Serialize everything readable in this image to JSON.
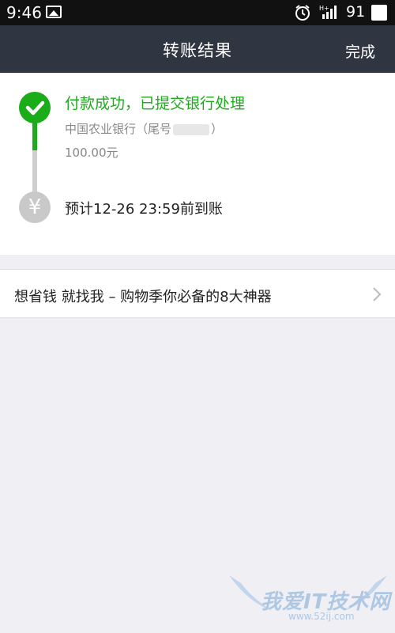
{
  "status_bar": {
    "time": "9:46",
    "battery": "91",
    "icons": [
      "image-icon",
      "alarm-icon",
      "signal-icon",
      "battery-icon"
    ]
  },
  "nav": {
    "title": "转账结果",
    "done_label": "完成"
  },
  "transfer": {
    "status": "付款成功，已提交银行处理",
    "bank_prefix": "中国农业银行（尾号",
    "bank_suffix": "）",
    "amount": "100.00元",
    "eta": "预计12-26 23:59前到账",
    "currency_symbol": "¥"
  },
  "promo": {
    "label": "想省钱 就找我 – 购物季你必备的8大神器"
  },
  "watermark": {
    "text": "我爱IT技术网",
    "url": "www.52ij.com"
  },
  "colors": {
    "accent_green": "#1aad19",
    "nav_bg": "#2f3642",
    "page_bg": "#efeff4"
  }
}
